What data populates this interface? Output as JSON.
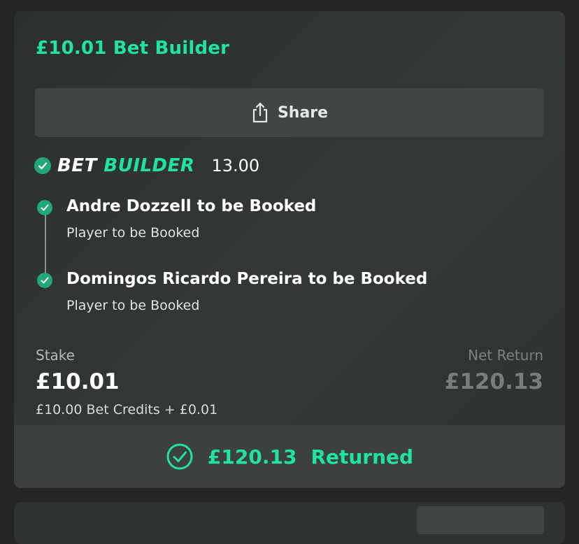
{
  "bet": {
    "title": "£10.01 Bet Builder",
    "share_label": "Share",
    "builder_logo_word1": "BET",
    "builder_logo_word2": "BUILDER",
    "odds": "13.00",
    "legs": [
      {
        "selection": "Andre Dozzell to be Booked",
        "market": "Player to be Booked"
      },
      {
        "selection": "Domingos Ricardo Pereira to be Booked",
        "market": "Player to be Booked"
      }
    ],
    "stake_label": "Stake",
    "stake_value": "£10.01",
    "stake_detail": "£10.00 Bet Credits + £0.01",
    "net_return_label": "Net Return",
    "net_return_value": "£120.13",
    "returned_amount": "£120.13",
    "returned_label": "Returned"
  },
  "colors": {
    "accent": "#1fe2a3",
    "check_green": "#22a77a",
    "card_bg": "#303533",
    "page_bg": "#252525"
  },
  "icons": [
    "share-icon",
    "check-icon",
    "returned-check-icon"
  ]
}
